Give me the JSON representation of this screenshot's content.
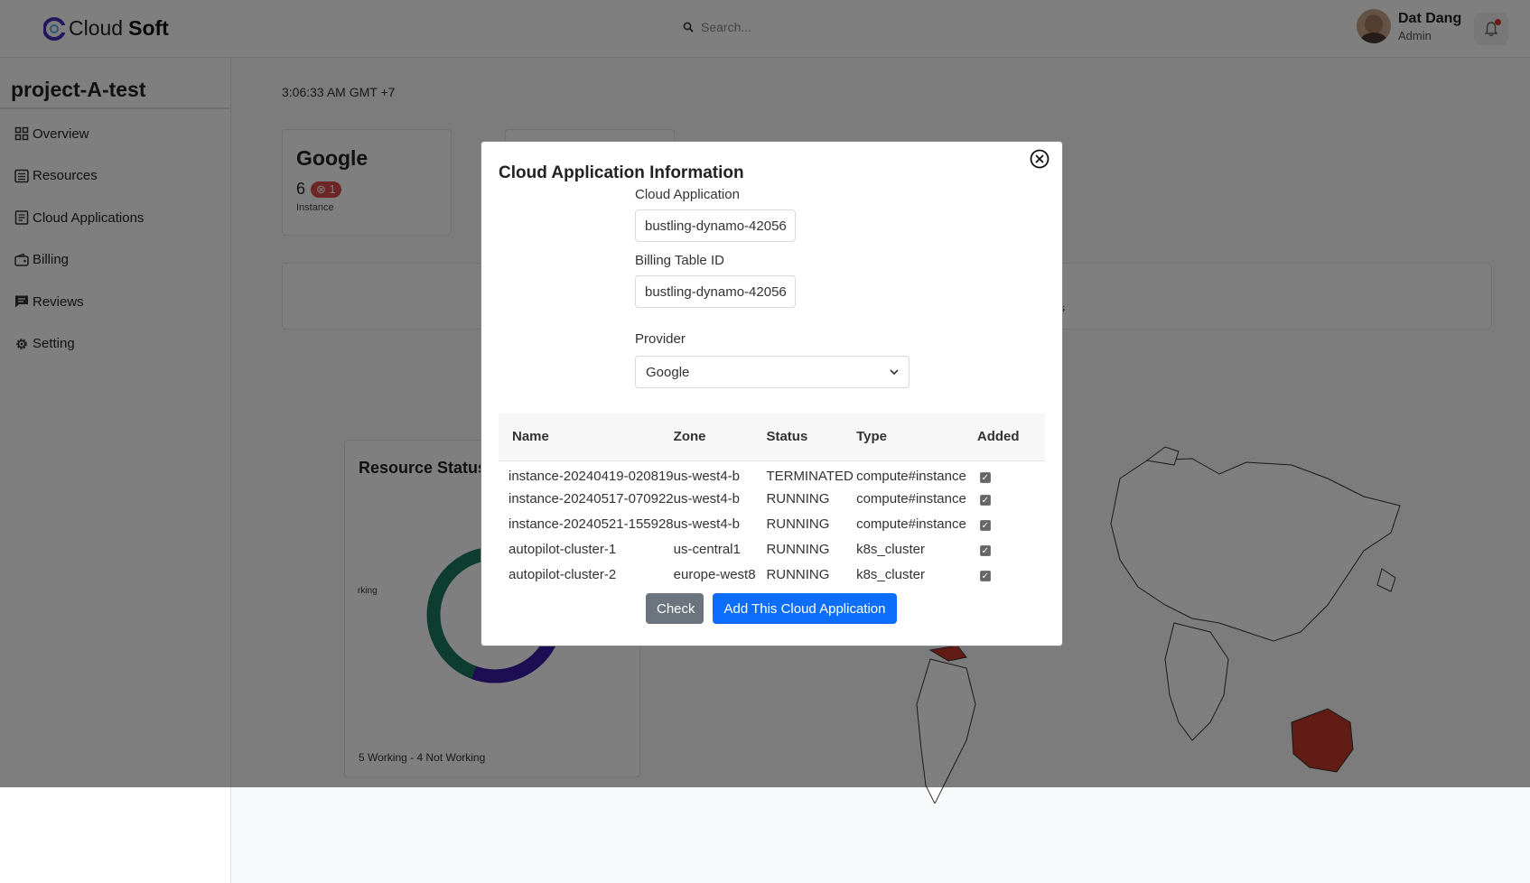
{
  "app": {
    "brand_first": "Cloud",
    "brand_second": "Soft"
  },
  "search": {
    "placeholder": "Search..."
  },
  "user": {
    "name": "Dat Dang",
    "role": "Admin"
  },
  "sidebar": {
    "project": "project-A-test",
    "items": [
      {
        "label": "Overview",
        "icon": "grid-icon"
      },
      {
        "label": "Resources",
        "icon": "list-icon"
      },
      {
        "label": "Cloud Applications",
        "icon": "document-icon"
      },
      {
        "label": "Billing",
        "icon": "wallet-icon"
      },
      {
        "label": "Reviews",
        "icon": "chat-icon"
      },
      {
        "label": "Setting",
        "icon": "gear-icon"
      }
    ]
  },
  "main": {
    "time": "3:06:33 AM GMT +7",
    "google_card": {
      "title": "Google",
      "count": "6",
      "error_count": "1",
      "sub": "Instance"
    },
    "resource_status": {
      "title": "Resource Status",
      "legend_partial": "rking",
      "footer": "5 Working - 4 Not Working"
    },
    "map_partial_text": "s"
  },
  "modal": {
    "title": "Cloud Application Information",
    "cloud_app_label": "Cloud Application",
    "cloud_app_value": "bustling-dynamo-42056",
    "billing_label": "Billing Table ID",
    "billing_value": "bustling-dynamo-42056",
    "provider_label": "Provider",
    "provider_value": "Google",
    "table": {
      "headers": [
        "Name",
        "Zone",
        "Status",
        "Type",
        "Added"
      ],
      "rows": [
        [
          "instance-20240419-020819",
          "us-west4-b",
          "TERMINATED",
          "compute#instance",
          true
        ],
        [
          "instance-20240517-070922",
          "us-west4-b",
          "RUNNING",
          "compute#instance",
          true
        ],
        [
          "instance-20240521-155928",
          "us-west4-b",
          "RUNNING",
          "compute#instance",
          true
        ],
        [
          "autopilot-cluster-1",
          "us-central1",
          "RUNNING",
          "k8s_cluster",
          true
        ],
        [
          "autopilot-cluster-2",
          "europe-west8",
          "RUNNING",
          "k8s_cluster",
          true
        ]
      ]
    },
    "check_label": "Check",
    "add_label": "Add This Cloud Application"
  },
  "colors": {
    "accent": "#0d6efd",
    "secondary": "#6c757d",
    "error": "#dc4b4b",
    "donut_green": "#1a7a63",
    "donut_purple": "#3a1aa6",
    "map_highlight": "#c0392b"
  }
}
